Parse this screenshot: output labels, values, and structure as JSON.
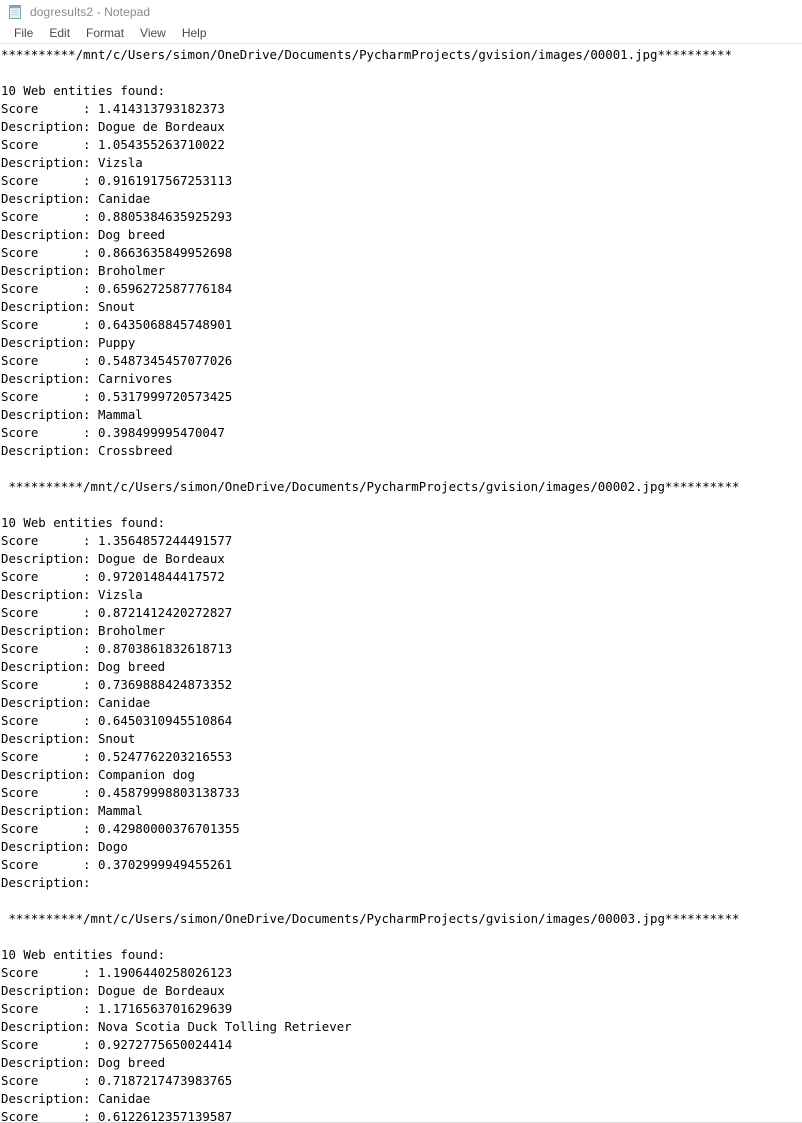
{
  "window": {
    "title": "dogresults2 - Notepad",
    "icon": "notepad-icon"
  },
  "menu": {
    "items": [
      {
        "label": "File"
      },
      {
        "label": "Edit"
      },
      {
        "label": "Format"
      },
      {
        "label": "View"
      },
      {
        "label": "Help"
      }
    ]
  },
  "document": {
    "entity_count_label": "10 Web entities found:",
    "score_label": "Score      ",
    "description_label": "Description",
    "separator_asterisks": "**********",
    "blocks": [
      {
        "indent": "",
        "path": "/mnt/c/Users/simon/OneDrive/Documents/PycharmProjects/gvision/images/00001.jpg",
        "count_line": "10 Web entities found:",
        "entries": [
          {
            "score": "1.414313793182373",
            "description": "Dogue de Bordeaux"
          },
          {
            "score": "1.054355263710022",
            "description": "Vizsla"
          },
          {
            "score": "0.9161917567253113",
            "description": "Canidae"
          },
          {
            "score": "0.8805384635925293",
            "description": "Dog breed"
          },
          {
            "score": "0.8663635849952698",
            "description": "Broholmer"
          },
          {
            "score": "0.6596272587776184",
            "description": "Snout"
          },
          {
            "score": "0.6435068845748901",
            "description": "Puppy"
          },
          {
            "score": "0.5487345457077026",
            "description": "Carnivores"
          },
          {
            "score": "0.5317999720573425",
            "description": "Mammal"
          },
          {
            "score": "0.398499995470047",
            "description": "Crossbreed"
          }
        ]
      },
      {
        "indent": " ",
        "path": "/mnt/c/Users/simon/OneDrive/Documents/PycharmProjects/gvision/images/00002.jpg",
        "count_line": "10 Web entities found:",
        "entries": [
          {
            "score": "1.3564857244491577",
            "description": "Dogue de Bordeaux"
          },
          {
            "score": "0.972014844417572",
            "description": "Vizsla"
          },
          {
            "score": "0.8721412420272827",
            "description": "Broholmer"
          },
          {
            "score": "0.8703861832618713",
            "description": "Dog breed"
          },
          {
            "score": "0.7369888424873352",
            "description": "Canidae"
          },
          {
            "score": "0.6450310945510864",
            "description": "Snout"
          },
          {
            "score": "0.5247762203216553",
            "description": "Companion dog"
          },
          {
            "score": "0.45879998803138733",
            "description": "Mammal"
          },
          {
            "score": "0.42980000376701355",
            "description": "Dogo"
          },
          {
            "score": "0.3702999949455261",
            "description": ""
          }
        ]
      },
      {
        "indent": " ",
        "path": "/mnt/c/Users/simon/OneDrive/Documents/PycharmProjects/gvision/images/00003.jpg",
        "count_line": "10 Web entities found:",
        "entries": [
          {
            "score": "1.1906440258026123",
            "description": "Dogue de Bordeaux"
          },
          {
            "score": "1.1716563701629639",
            "description": "Nova Scotia Duck Tolling Retriever"
          },
          {
            "score": "0.9272775650024414",
            "description": "Dog breed"
          },
          {
            "score": "0.7187217473983765",
            "description": "Canidae"
          },
          {
            "score": "0.6122612357139587",
            "description": null
          }
        ]
      }
    ]
  }
}
